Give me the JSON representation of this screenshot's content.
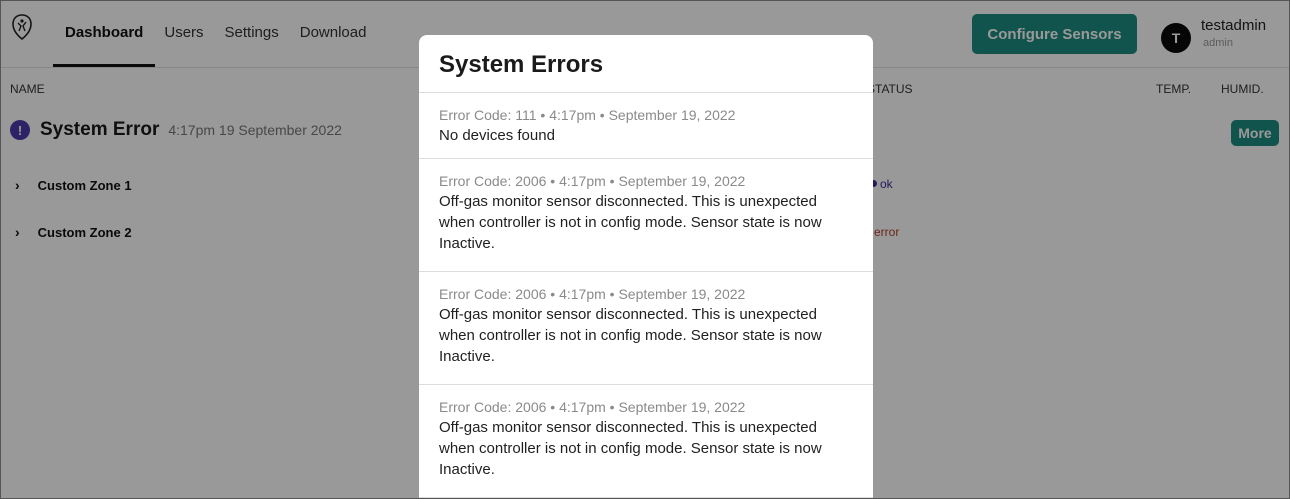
{
  "header": {
    "nav": [
      "Dashboard",
      "Users",
      "Settings",
      "Download"
    ],
    "configure_label": "Configure Sensors",
    "avatar_initial": "T",
    "user_name": "testadmin",
    "user_role": "admin"
  },
  "table": {
    "columns": {
      "name": "NAME",
      "status": "STATUS",
      "temp": "TEMP.",
      "humid": "HUMID."
    },
    "system_error": {
      "icon": "!",
      "title": "System Error",
      "time": "4:17pm 19 September 2022",
      "more_label": "More"
    },
    "zones": [
      {
        "name": "Custom Zone 1",
        "status": "ok"
      },
      {
        "name": "Custom Zone 2",
        "status": "error"
      }
    ]
  },
  "modal": {
    "title": "System Errors",
    "errors": [
      {
        "meta": "Error Code: 111 • 4:17pm • September 19, 2022",
        "message": "No devices found"
      },
      {
        "meta": "Error Code: 2006 • 4:17pm • September 19, 2022",
        "message": "Off-gas monitor sensor disconnected. This is unexpected when controller is not in config mode. Sensor state is now Inactive."
      },
      {
        "meta": "Error Code: 2006 • 4:17pm • September 19, 2022",
        "message": "Off-gas monitor sensor disconnected. This is unexpected when controller is not in config mode. Sensor state is now Inactive."
      },
      {
        "meta": "Error Code: 2006 • 4:17pm • September 19, 2022",
        "message": "Off-gas monitor sensor disconnected. This is unexpected when controller is not in config mode. Sensor state is now Inactive."
      }
    ]
  },
  "colors": {
    "accent": "#1d8a80",
    "error_icon": "#4a3aa8",
    "status_ok": "#3b2e99",
    "status_error": "#b3412b"
  }
}
